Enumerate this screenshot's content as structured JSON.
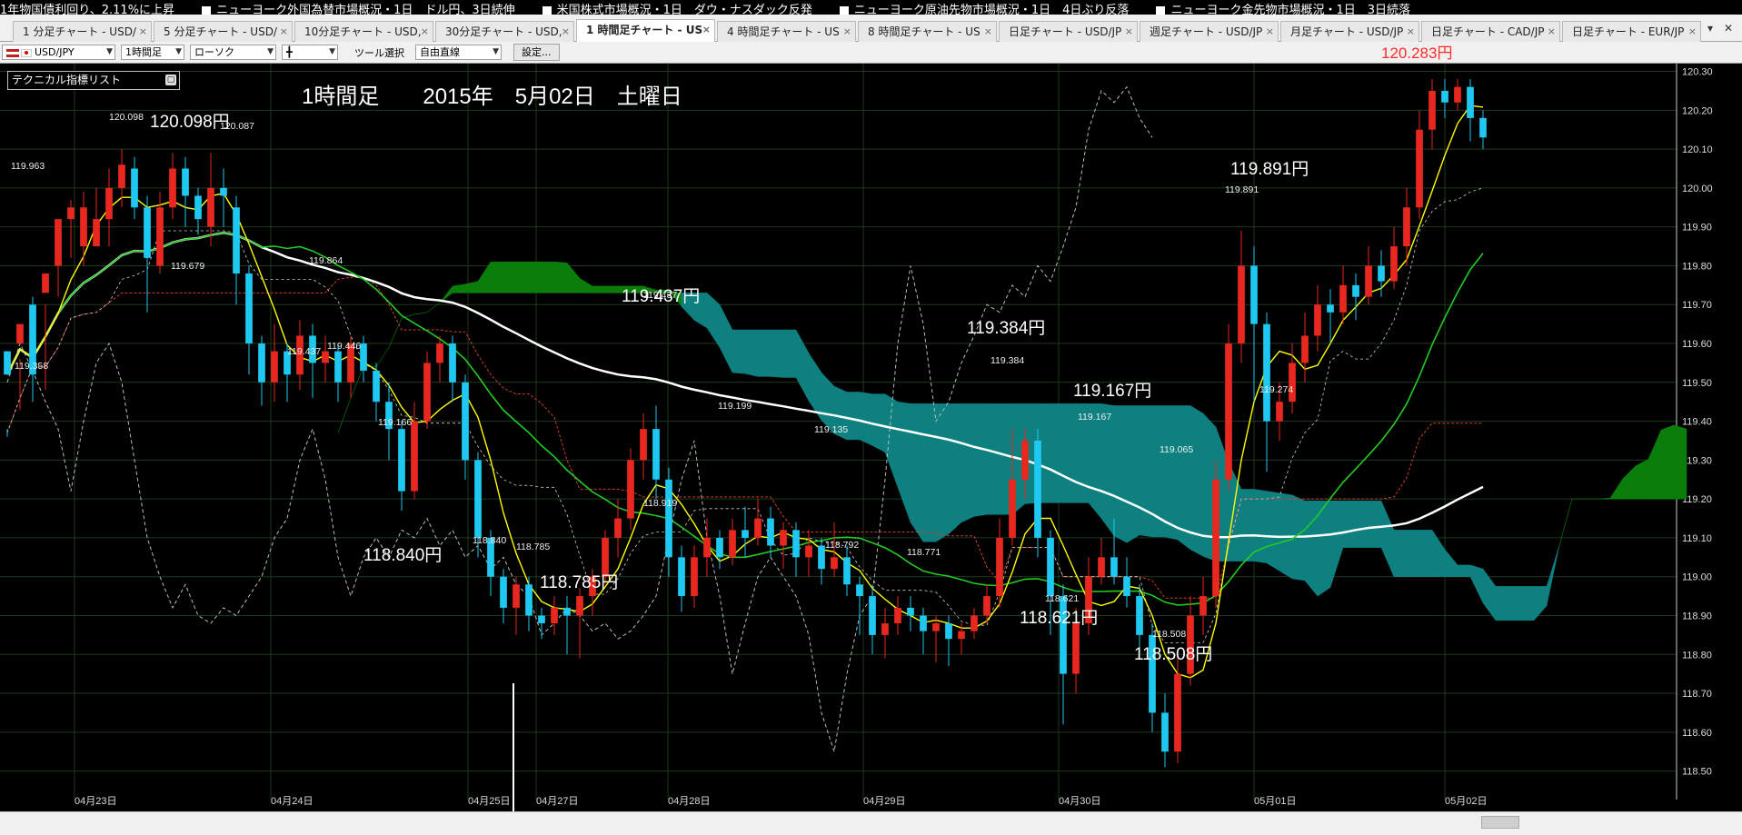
{
  "ticker": [
    "1年物国債利回り、2.11%に上昇",
    "ニューヨーク外国為替市場概況・1日　ドル円、3日続伸",
    "米国株式市場概況・1日　ダウ・ナスダック反発",
    "ニューヨーク原油先物市場概況・1日　4日ぶり反落",
    "ニューヨーク金先物市場概況・1日　3日続落"
  ],
  "tabs": [
    {
      "label": "1 分足チャート - USD/",
      "active": false
    },
    {
      "label": "5 分足チャート - USD/",
      "active": false
    },
    {
      "label": "10分足チャート - USD,",
      "active": false
    },
    {
      "label": "30分足チャート - USD,",
      "active": false
    },
    {
      "label": "1 時間足チャート - US",
      "active": true
    },
    {
      "label": "4 時間足チャート - US",
      "active": false
    },
    {
      "label": "8 時間足チャート - US",
      "active": false
    },
    {
      "label": "日足チャート - USD/JP",
      "active": false
    },
    {
      "label": "週足チャート - USD/JP",
      "active": false
    },
    {
      "label": "月足チャート - USD/JP",
      "active": false
    },
    {
      "label": "日足チャート - CAD/JP",
      "active": false
    },
    {
      "label": "日足チャート - EUR/JP",
      "active": false
    }
  ],
  "toolbar": {
    "pair": "USD/JPY",
    "timeframe": "1時間足",
    "chart_type": "ローソク",
    "style": "╋",
    "tool_label": "ツール選択",
    "tool_value": "自由直線",
    "settings_label": "設定..."
  },
  "current_price": "120.283円",
  "indicator_list_label": "テクニカル指標リスト",
  "chart_data": {
    "type": "candlestick",
    "title": "1時間足　　2015年　5月02日　土曜日",
    "ylim": [
      118.45,
      120.32
    ],
    "y_ticks": [
      118.5,
      118.6,
      118.7,
      118.8,
      118.9,
      119.0,
      119.1,
      119.2,
      119.3,
      119.4,
      119.5,
      119.6,
      119.7,
      119.8,
      119.9,
      120.0,
      120.1,
      120.2,
      120.3
    ],
    "x_labels": [
      "04月23日",
      "04月24日",
      "04月25日",
      "04月27日",
      "04月28日",
      "04月29日",
      "04月30日",
      "05月01日",
      "05月02日"
    ],
    "series_notes": [
      "ichimoku cloud",
      "moving averages",
      "lagging span"
    ],
    "candles": [
      [
        119.58,
        119.52,
        119.38,
        119.36
      ],
      [
        119.6,
        119.65,
        119.56,
        119.43
      ],
      [
        119.7,
        119.52,
        119.72,
        119.45
      ],
      [
        119.73,
        119.78,
        119.7,
        119.48
      ],
      [
        119.8,
        119.92,
        119.82,
        119.72
      ],
      [
        119.92,
        119.95,
        119.97,
        119.82
      ],
      [
        119.85,
        119.95,
        119.99,
        119.8
      ],
      [
        119.85,
        119.92,
        120.0,
        119.85
      ],
      [
        119.92,
        120.0,
        120.05,
        119.85
      ],
      [
        120.0,
        120.06,
        120.1,
        119.95
      ],
      [
        120.05,
        119.95,
        120.08,
        119.92
      ],
      [
        119.95,
        119.82,
        119.98,
        119.68
      ],
      [
        119.8,
        119.95,
        119.99,
        119.78
      ],
      [
        119.95,
        120.05,
        120.09,
        119.92
      ],
      [
        120.05,
        119.98,
        120.08,
        119.9
      ],
      [
        119.98,
        119.92,
        120.0,
        119.88
      ],
      [
        119.9,
        120.0,
        120.09,
        119.85
      ],
      [
        120.0,
        119.98,
        120.05,
        119.9
      ],
      [
        119.95,
        119.78,
        119.98,
        119.7
      ],
      [
        119.78,
        119.6,
        119.8,
        119.52
      ],
      [
        119.6,
        119.5,
        119.62,
        119.44
      ],
      [
        119.5,
        119.58,
        119.65,
        119.45
      ],
      [
        119.58,
        119.52,
        119.6,
        119.45
      ],
      [
        119.52,
        119.62,
        119.66,
        119.48
      ],
      [
        119.62,
        119.55,
        119.65,
        119.46
      ],
      [
        119.55,
        119.58,
        119.62,
        119.5
      ],
      [
        119.58,
        119.5,
        119.6,
        119.45
      ],
      [
        119.5,
        119.6,
        119.62,
        119.46
      ],
      [
        119.6,
        119.53,
        119.62,
        119.5
      ],
      [
        119.53,
        119.45,
        119.55,
        119.4
      ],
      [
        119.45,
        119.38,
        119.5,
        119.3
      ],
      [
        119.38,
        119.22,
        119.4,
        119.17
      ],
      [
        119.22,
        119.4,
        119.45,
        119.2
      ],
      [
        119.4,
        119.55,
        119.58,
        119.38
      ],
      [
        119.55,
        119.6,
        119.62,
        119.5
      ],
      [
        119.6,
        119.5,
        119.62,
        119.45
      ],
      [
        119.5,
        119.3,
        119.52,
        119.25
      ],
      [
        119.3,
        119.1,
        119.32,
        119.05
      ],
      [
        119.1,
        119.0,
        119.12,
        118.95
      ],
      [
        119.0,
        118.92,
        119.02,
        118.88
      ],
      [
        118.92,
        118.98,
        119.0,
        118.85
      ],
      [
        118.98,
        118.9,
        119.0,
        118.86
      ],
      [
        118.9,
        118.88,
        118.92,
        118.84
      ],
      [
        118.88,
        118.92,
        118.95,
        118.85
      ],
      [
        118.92,
        118.9,
        118.95,
        118.8
      ],
      [
        118.9,
        118.95,
        118.97,
        118.79
      ],
      [
        118.95,
        119.0,
        119.02,
        118.9
      ],
      [
        119.0,
        119.1,
        119.12,
        118.98
      ],
      [
        119.1,
        119.15,
        119.2,
        119.05
      ],
      [
        119.15,
        119.3,
        119.33,
        119.12
      ],
      [
        119.3,
        119.38,
        119.42,
        119.25
      ],
      [
        119.38,
        119.25,
        119.44,
        119.2
      ],
      [
        119.25,
        119.05,
        119.28,
        119.0
      ],
      [
        119.05,
        118.95,
        119.08,
        118.91
      ],
      [
        118.95,
        119.05,
        119.08,
        118.92
      ],
      [
        119.05,
        119.1,
        119.15,
        119.0
      ],
      [
        119.1,
        119.05,
        119.12,
        119.02
      ],
      [
        119.05,
        119.12,
        119.15,
        119.03
      ],
      [
        119.12,
        119.1,
        119.18,
        119.05
      ],
      [
        119.1,
        119.15,
        119.2,
        119.08
      ],
      [
        119.15,
        119.08,
        119.18,
        119.05
      ],
      [
        119.08,
        119.12,
        119.14,
        119.02
      ],
      [
        119.12,
        119.05,
        119.14,
        119.0
      ],
      [
        119.05,
        119.08,
        119.12,
        119.0
      ],
      [
        119.08,
        119.02,
        119.1,
        118.98
      ],
      [
        119.02,
        119.05,
        119.14,
        119.0
      ],
      [
        119.05,
        118.98,
        119.08,
        118.95
      ],
      [
        118.98,
        118.95,
        119.0,
        118.85
      ],
      [
        118.95,
        118.85,
        118.98,
        118.8
      ],
      [
        118.85,
        118.88,
        118.92,
        118.79
      ],
      [
        118.88,
        118.92,
        118.95,
        118.85
      ],
      [
        118.92,
        118.9,
        118.95,
        118.86
      ],
      [
        118.9,
        118.86,
        118.92,
        118.8
      ],
      [
        118.86,
        118.88,
        118.9,
        118.78
      ],
      [
        118.88,
        118.84,
        118.9,
        118.77
      ],
      [
        118.84,
        118.86,
        118.88,
        118.8
      ],
      [
        118.86,
        118.9,
        118.92,
        118.84
      ],
      [
        118.9,
        118.95,
        118.98,
        118.88
      ],
      [
        118.95,
        119.1,
        119.15,
        118.92
      ],
      [
        119.1,
        119.25,
        119.38,
        119.08
      ],
      [
        119.25,
        119.35,
        119.38,
        119.2
      ],
      [
        119.35,
        119.1,
        119.38,
        119.05
      ],
      [
        119.1,
        118.95,
        119.12,
        118.85
      ],
      [
        118.95,
        118.75,
        118.98,
        118.62
      ],
      [
        118.75,
        118.88,
        118.92,
        118.7
      ],
      [
        118.88,
        119.0,
        119.05,
        118.85
      ],
      [
        119.0,
        119.05,
        119.1,
        118.98
      ],
      [
        119.05,
        119.0,
        119.15,
        118.98
      ],
      [
        119.0,
        118.95,
        119.05,
        118.92
      ],
      [
        118.95,
        118.85,
        118.98,
        118.8
      ],
      [
        118.85,
        118.65,
        118.88,
        118.6
      ],
      [
        118.65,
        118.55,
        118.7,
        118.51
      ],
      [
        118.55,
        118.75,
        118.8,
        118.52
      ],
      [
        118.75,
        118.9,
        118.95,
        118.72
      ],
      [
        118.9,
        118.95,
        119.0,
        118.85
      ],
      [
        118.95,
        119.25,
        119.3,
        118.92
      ],
      [
        119.25,
        119.6,
        119.65,
        119.22
      ],
      [
        119.6,
        119.8,
        119.89,
        119.55
      ],
      [
        119.8,
        119.65,
        119.85,
        119.45
      ],
      [
        119.65,
        119.4,
        119.68,
        119.27
      ],
      [
        119.4,
        119.45,
        119.5,
        119.35
      ],
      [
        119.45,
        119.55,
        119.6,
        119.42
      ],
      [
        119.55,
        119.62,
        119.68,
        119.5
      ],
      [
        119.62,
        119.7,
        119.75,
        119.58
      ],
      [
        119.7,
        119.68,
        119.74,
        119.6
      ],
      [
        119.68,
        119.75,
        119.8,
        119.65
      ],
      [
        119.75,
        119.72,
        119.78,
        119.66
      ],
      [
        119.72,
        119.8,
        119.85,
        119.7
      ],
      [
        119.8,
        119.76,
        119.84,
        119.72
      ],
      [
        119.76,
        119.85,
        119.9,
        119.74
      ],
      [
        119.85,
        119.95,
        120.0,
        119.8
      ],
      [
        119.95,
        120.15,
        120.2,
        119.92
      ],
      [
        120.15,
        120.25,
        120.28,
        120.1
      ],
      [
        120.25,
        120.22,
        120.28,
        120.18
      ],
      [
        120.22,
        120.26,
        120.28,
        120.2
      ],
      [
        120.26,
        120.18,
        120.28,
        120.12
      ],
      [
        120.18,
        120.13,
        120.2,
        120.1
      ]
    ],
    "annotations": [
      {
        "text": "120.098円",
        "small": "120.098",
        "value": 120.098
      },
      {
        "text": "",
        "small": "120.087",
        "value": 120.087
      },
      {
        "text": "",
        "small": "119.963",
        "value": 119.963
      },
      {
        "text": "",
        "small": "119.679",
        "value": 119.679
      },
      {
        "text": "",
        "small": "119.864",
        "value": 119.864
      },
      {
        "text": "",
        "small": "119.437",
        "value": 119.437
      },
      {
        "text": "",
        "small": "119.446",
        "value": 119.446
      },
      {
        "text": "",
        "small": "119.358",
        "value": 119.358
      },
      {
        "text": "",
        "small": "119.166",
        "value": 119.166
      },
      {
        "text": "118.840円",
        "small": "118.840",
        "value": 118.84
      },
      {
        "text": "118.785円",
        "small": "118.785",
        "value": 118.785
      },
      {
        "text": "119.437円",
        "small": "119.437",
        "value": 119.437
      },
      {
        "text": "",
        "small": "119.199",
        "value": 119.199
      },
      {
        "text": "",
        "small": "119.135",
        "value": 119.135
      },
      {
        "text": "",
        "small": "118.919",
        "value": 118.919
      },
      {
        "text": "",
        "small": "118.792",
        "value": 118.792
      },
      {
        "text": "",
        "small": "118.771",
        "value": 118.771
      },
      {
        "text": "119.384円",
        "small": "119.384",
        "value": 119.384
      },
      {
        "text": "119.167円",
        "small": "119.167",
        "value": 119.167
      },
      {
        "text": "118.621円",
        "small": "118.621",
        "value": 118.621
      },
      {
        "text": "",
        "small": "119.065",
        "value": 119.065
      },
      {
        "text": "118.508円",
        "small": "118.508",
        "value": 118.508
      },
      {
        "text": "119.891円",
        "small": "119.891",
        "value": 119.891
      },
      {
        "text": "",
        "small": "119.274",
        "value": 119.274
      }
    ],
    "colors": {
      "up": "#e8281e",
      "down": "#1ec8f0",
      "cloud_bull": "#0a7d0a",
      "cloud_bear": "#0e8080",
      "ma_yellow": "#ffff00",
      "ma_green": "#22cc22",
      "ma_white": "#ffffff",
      "grid": "#1d3a1d"
    }
  }
}
